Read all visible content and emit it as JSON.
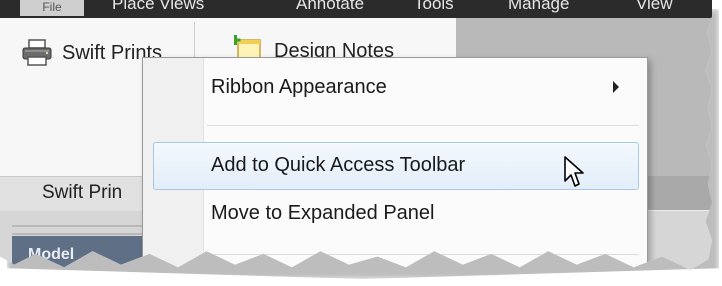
{
  "menubar": {
    "items": [
      "File",
      "Place Views",
      "Annotate",
      "Tools",
      "Manage",
      "View"
    ]
  },
  "ribbon": {
    "swift_prints_label": "Swift Prints",
    "design_notes_label": "Design Notes",
    "panel_title": "Swift Prin",
    "lower_label": "Model"
  },
  "context_menu": {
    "items": [
      {
        "label": "Ribbon Appearance",
        "has_submenu": true
      },
      {
        "label": "Add to Quick Access Toolbar",
        "highlighted": true
      },
      {
        "label": "Move to Expanded Panel"
      }
    ]
  },
  "colors": {
    "highlight_border": "#a9c8e8",
    "highlight_fill": "#e3eef9",
    "menubar_bg": "#2b2b2b"
  },
  "icons": {
    "swift_prints": "printer-icon",
    "design_notes": "note-add-icon",
    "submenu": "chevron-right-icon",
    "cursor": "pointer-cursor-icon"
  }
}
